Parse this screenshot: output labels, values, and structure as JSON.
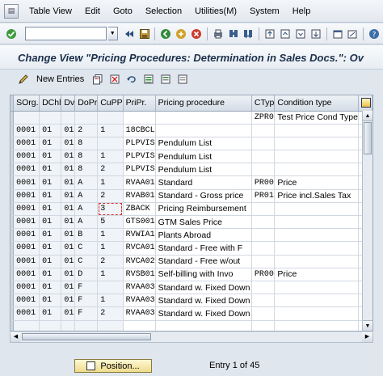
{
  "menu": [
    "Table View",
    "Edit",
    "Goto",
    "Selection",
    "Utilities(M)",
    "System",
    "Help"
  ],
  "title": "Change View \"Pricing Procedures: Determination in Sales Docs.\": Ov",
  "app_toolbar": {
    "new_entries": "New Entries"
  },
  "table": {
    "headers": [
      "SOrg.",
      "DChl",
      "Dv",
      "DoPr",
      "CuPP",
      "PriPr.",
      "Pricing procedure",
      "CTyp",
      "Condition type"
    ],
    "rows": [
      [
        "",
        "",
        "",
        "",
        "",
        "",
        "",
        "ZPR0",
        "Test Price Cond Type"
      ],
      [
        "0001",
        "01",
        "01",
        "2",
        "1",
        "18CBCL",
        "",
        "",
        ""
      ],
      [
        "0001",
        "01",
        "01",
        "8",
        "",
        "PLPVIS",
        "Pendulum List",
        "",
        ""
      ],
      [
        "0001",
        "01",
        "01",
        "8",
        "1",
        "PLPVIS",
        "Pendulum List",
        "",
        ""
      ],
      [
        "0001",
        "01",
        "01",
        "8",
        "2",
        "PLPVIS",
        "Pendulum List",
        "",
        ""
      ],
      [
        "0001",
        "01",
        "01",
        "A",
        "1",
        "RVAA01",
        "Standard",
        "PR00",
        "Price"
      ],
      [
        "0001",
        "01",
        "01",
        "A",
        "2",
        "RVAB01",
        "Standard - Gross price",
        "PR01",
        "Price incl.Sales Tax"
      ],
      [
        "0001",
        "01",
        "01",
        "A",
        "3",
        "ZBACK",
        "Pricing Reimbursement",
        "",
        ""
      ],
      [
        "0001",
        "01",
        "01",
        "A",
        "5",
        "GTS001",
        "GTM Sales Price",
        "",
        ""
      ],
      [
        "0001",
        "01",
        "01",
        "B",
        "1",
        "RVWIA1",
        "Plants Abroad",
        "",
        ""
      ],
      [
        "0001",
        "01",
        "01",
        "C",
        "1",
        "RVCA01",
        "Standard - Free with F",
        "",
        ""
      ],
      [
        "0001",
        "01",
        "01",
        "C",
        "2",
        "RVCA02",
        "Standard - Free w/out",
        "",
        ""
      ],
      [
        "0001",
        "01",
        "01",
        "D",
        "1",
        "RVSB01",
        "Self-billing with Invo",
        "PR00",
        "Price"
      ],
      [
        "0001",
        "01",
        "01",
        "F",
        "",
        "RVAA03",
        "Standard w. Fixed Down",
        "",
        ""
      ],
      [
        "0001",
        "01",
        "01",
        "F",
        "1",
        "RVAA03",
        "Standard w. Fixed Down",
        "",
        ""
      ],
      [
        "0001",
        "01",
        "01",
        "F",
        "2",
        "RVAA03",
        "Standard w. Fixed Down",
        "",
        ""
      ],
      [
        "",
        "",
        "",
        "",
        "",
        "",
        "",
        "",
        ""
      ]
    ]
  },
  "position_button": "Position...",
  "entry_info": "Entry 1 of 45",
  "colors": {
    "background": "#dfe6ee",
    "header": "#d4dce6",
    "position_button": "#eedc8e"
  }
}
